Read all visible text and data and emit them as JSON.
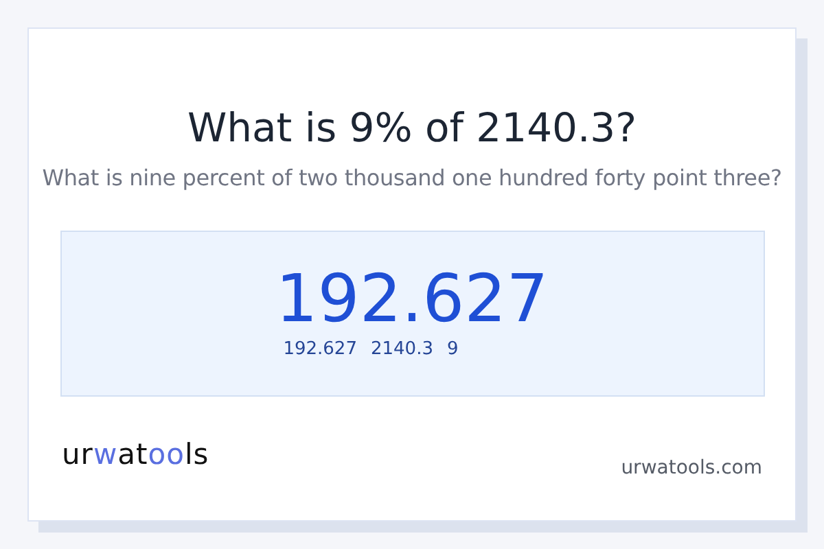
{
  "title": "What is 9% of 2140.3?",
  "subtitle": "What is nine percent of two thousand one hundred forty point three?",
  "result": {
    "value": "192.627",
    "details": [
      "192.627",
      "2140.3",
      "9"
    ]
  },
  "logo": [
    {
      "text": "ur",
      "accent": false
    },
    {
      "text": "w",
      "accent": true
    },
    {
      "text": "at",
      "accent": false
    },
    {
      "text": "oo",
      "accent": true
    },
    {
      "text": "ls",
      "accent": false
    }
  ],
  "site": "urwatools.com"
}
